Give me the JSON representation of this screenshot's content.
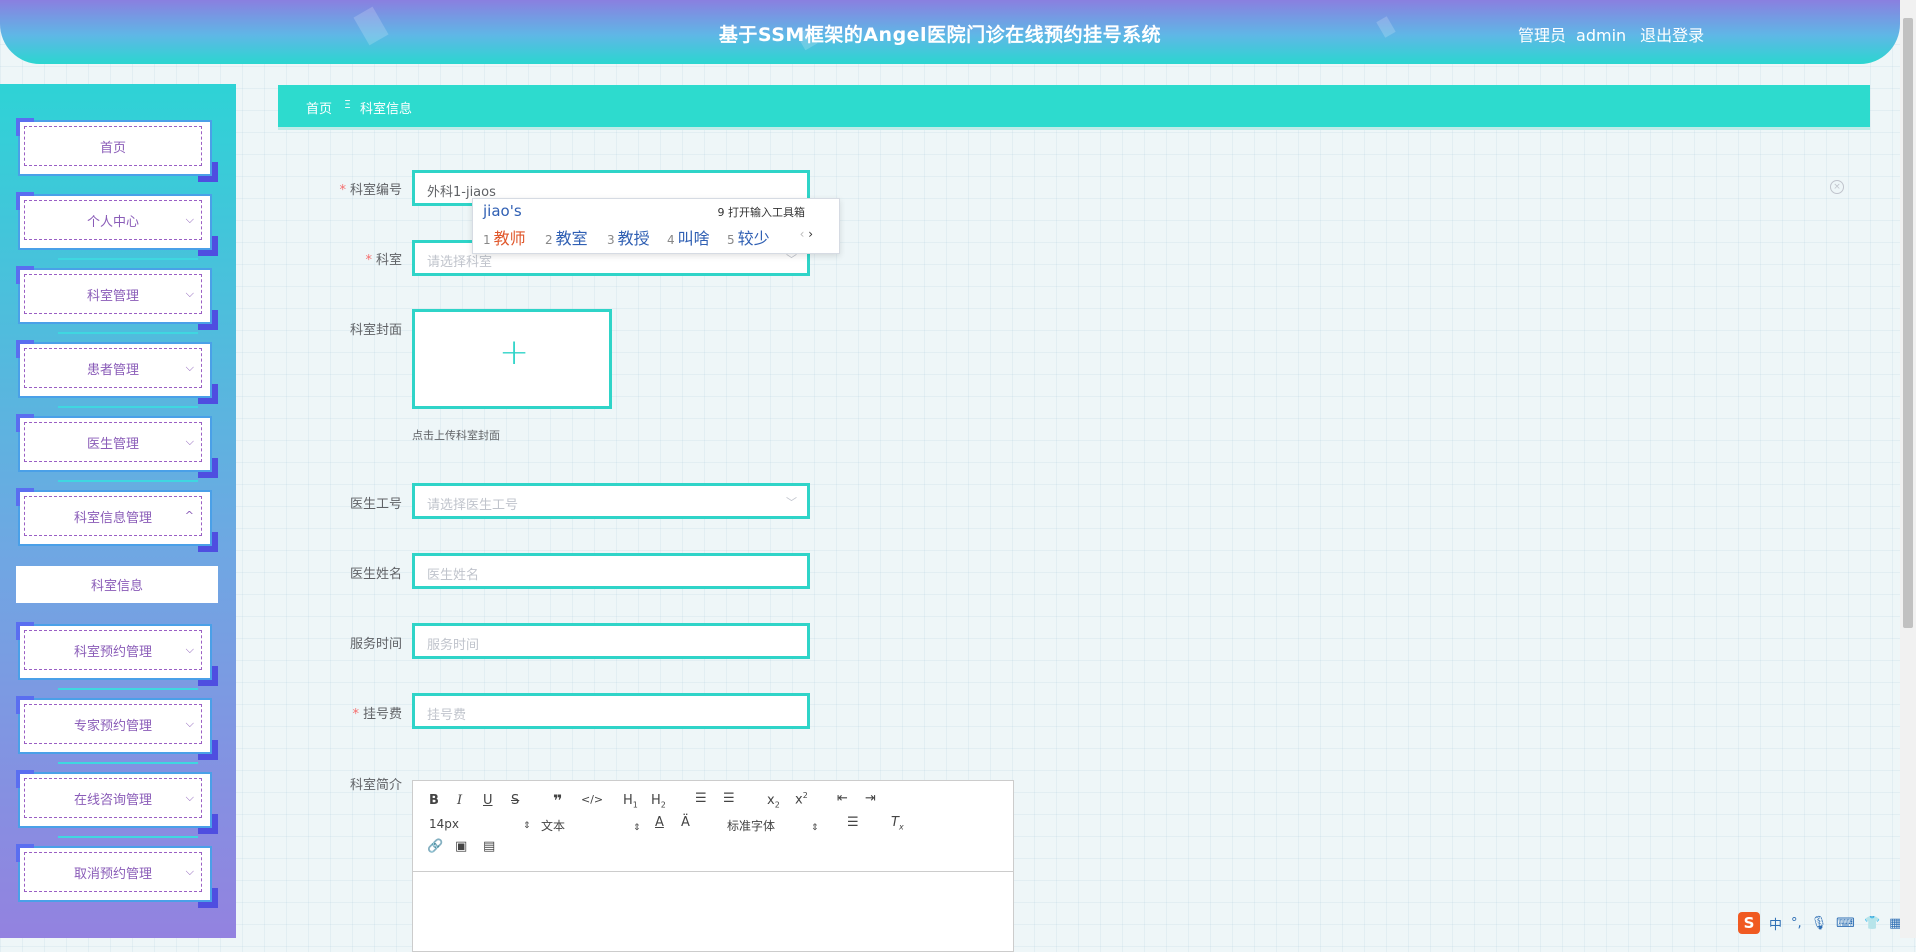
{
  "header": {
    "title": "基于SSM框架的Angel医院门诊在线预约挂号系统",
    "user_role": "管理员",
    "username": "admin",
    "logout": "退出登录"
  },
  "sidebar": {
    "items": [
      {
        "label": "首页",
        "has_arrow": false
      },
      {
        "label": "个人中心",
        "arrow": "⌵"
      },
      {
        "label": "科室管理",
        "arrow": "⌵"
      },
      {
        "label": "患者管理",
        "arrow": "⌵"
      },
      {
        "label": "医生管理",
        "arrow": "⌵"
      },
      {
        "label": "科室信息管理",
        "arrow": "^"
      },
      {
        "label": "科室预约管理",
        "arrow": "⌵"
      },
      {
        "label": "专家预约管理",
        "arrow": "⌵"
      },
      {
        "label": "在线咨询管理",
        "arrow": "⌵"
      },
      {
        "label": "取消预约管理",
        "arrow": "⌵"
      }
    ],
    "submenu": {
      "label": "科室信息"
    }
  },
  "breadcrumb": {
    "home": "首页",
    "separator": "Ξ",
    "current": "科室信息"
  },
  "form": {
    "dept_no": {
      "label": "科室编号",
      "value": "外科1-jiaos",
      "required": true
    },
    "dept": {
      "label": "科室",
      "placeholder": "请选择科室",
      "required": true
    },
    "cover": {
      "label": "科室封面",
      "tip": "点击上传科室封面"
    },
    "doctor_id": {
      "label": "医生工号",
      "placeholder": "请选择医生工号"
    },
    "doctor_name": {
      "label": "医生姓名",
      "placeholder": "医生姓名"
    },
    "service_time": {
      "label": "服务时间",
      "placeholder": "服务时间"
    },
    "fee": {
      "label": "挂号费",
      "placeholder": "挂号费",
      "required": true
    },
    "intro": {
      "label": "科室简介"
    }
  },
  "editor": {
    "font_size": "14px",
    "text_type": "文本",
    "font_family": "标准字体"
  },
  "ime": {
    "typed": "jiao's",
    "tools_label": "9 打开输入工具箱",
    "candidates": [
      {
        "n": "1",
        "text": "教师"
      },
      {
        "n": "2",
        "text": "教室"
      },
      {
        "n": "3",
        "text": "教授"
      },
      {
        "n": "4",
        "text": "叫啥"
      },
      {
        "n": "5",
        "text": "较少"
      }
    ]
  },
  "tray": {
    "ime_lang": "中",
    "punct": "°,"
  },
  "colors": {
    "accent": "#2fd4c8",
    "menu_text": "#8a5cb8",
    "required": "#f56c6c"
  }
}
